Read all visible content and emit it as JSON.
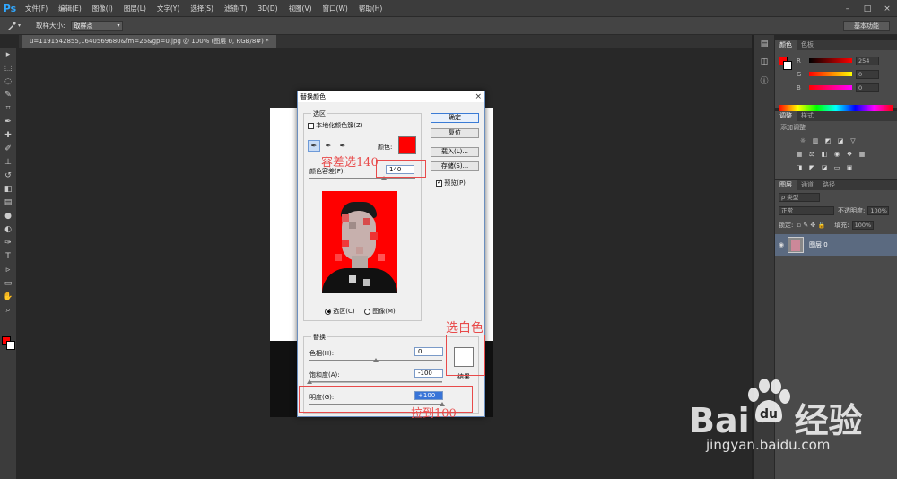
{
  "app": {
    "logo": "Ps",
    "menu": [
      "文件(F)",
      "编辑(E)",
      "图像(I)",
      "图层(L)",
      "文字(Y)",
      "选择(S)",
      "滤镜(T)",
      "3D(D)",
      "视图(V)",
      "窗口(W)",
      "帮助(H)"
    ],
    "window_controls": [
      "–",
      "□",
      "×"
    ]
  },
  "options_bar": {
    "tool_icon": "eyedropper-icon",
    "sample_size_label": "取样大小:",
    "sample_size_value": "取样点",
    "workspace": "基本功能"
  },
  "document": {
    "tab_title": "u=1191542855,1640569680&fm=26&gp=0.jpg @ 100% (图层 0, RGB/8#) *"
  },
  "dialog": {
    "title": "替换颜色",
    "close": "×",
    "selection_group": "选区",
    "localized_clusters_label": "本地化颜色簇(Z)",
    "localized_clusters_checked": false,
    "color_label": "颜色:",
    "selected_color": "#ff0000",
    "fuzziness_label": "颜色容差(F):",
    "fuzziness_value": "140",
    "fuzziness_fraction": 0.7,
    "radio_selection": "选区(C)",
    "radio_image": "图像(M)",
    "replace_group": "替换",
    "hue_label": "色相(H):",
    "hue_value": "0",
    "hue_fraction": 0.5,
    "saturation_label": "饱和度(A):",
    "saturation_value": "-100",
    "saturation_fraction": 0.0,
    "lightness_label": "明度(G):",
    "lightness_value": "+100",
    "lightness_fraction": 1.0,
    "result_label": "结果",
    "result_color": "#ffffff",
    "buttons": {
      "ok": "确定",
      "reset": "复位",
      "load": "载入(L)...",
      "save": "存储(S)...",
      "preview": "预览(P)"
    },
    "preview_checked": true
  },
  "annotations": {
    "fuzziness_note": "容差选140",
    "white_note": "选白色",
    "lightness_note": "拉到100"
  },
  "color_panel": {
    "tabs": [
      "颜色",
      "色板"
    ],
    "channels": [
      {
        "label": "R",
        "value": "254"
      },
      {
        "label": "G",
        "value": "0"
      },
      {
        "label": "B",
        "value": "0"
      }
    ],
    "fg_color": "#ff0000"
  },
  "adjust_panel": {
    "tabs": [
      "调整",
      "样式"
    ],
    "title": "添加调整"
  },
  "layers_panel": {
    "tabs": [
      "图层",
      "通道",
      "路径"
    ],
    "filter": "ρ 类型",
    "blend_mode": "正常",
    "opacity_label": "不透明度:",
    "opacity_value": "100%",
    "lock_label": "锁定:",
    "fill_label": "填充:",
    "fill_value": "100%",
    "layer_name": "图层 0"
  },
  "watermark": {
    "brand": "Bai",
    "brand2": "经验",
    "url": "jingyan.baidu.com"
  }
}
